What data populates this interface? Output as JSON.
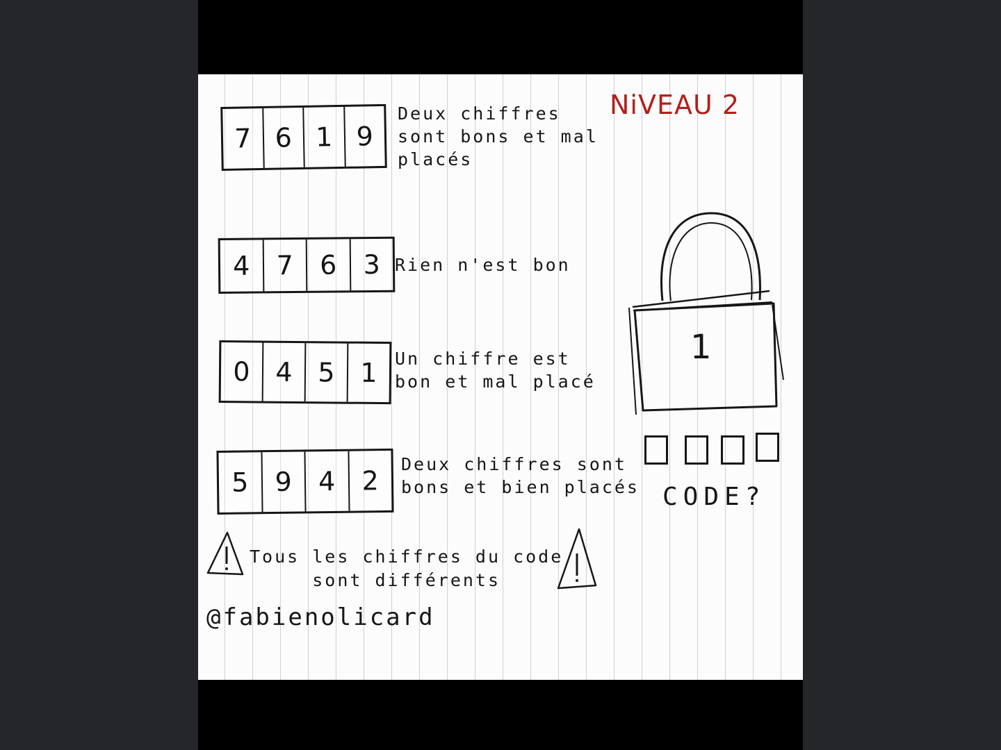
{
  "level": "NiVEAU 2",
  "clues": [
    {
      "digits": [
        "7",
        "6",
        "1",
        "9"
      ],
      "text": "Deux chiffres\nsont bons et mal\nplacés"
    },
    {
      "digits": [
        "4",
        "7",
        "6",
        "3"
      ],
      "text": "Rien n'est bon"
    },
    {
      "digits": [
        "0",
        "4",
        "5",
        "1"
      ],
      "text": "Un chiffre est\nbon et mal placé"
    },
    {
      "digits": [
        "5",
        "9",
        "4",
        "2"
      ],
      "text": "Deux chiffres sont\nbons et bien placés"
    }
  ],
  "warning": "Tous les chiffres du code\nsont différents",
  "author": "@fabienolicard",
  "padlock": {
    "digit": "1"
  },
  "code_label": "CODE?",
  "colors": {
    "ink": "#161616",
    "title_red": "#b3201c",
    "paper": "#fcfcfd",
    "background": "#25262a"
  }
}
